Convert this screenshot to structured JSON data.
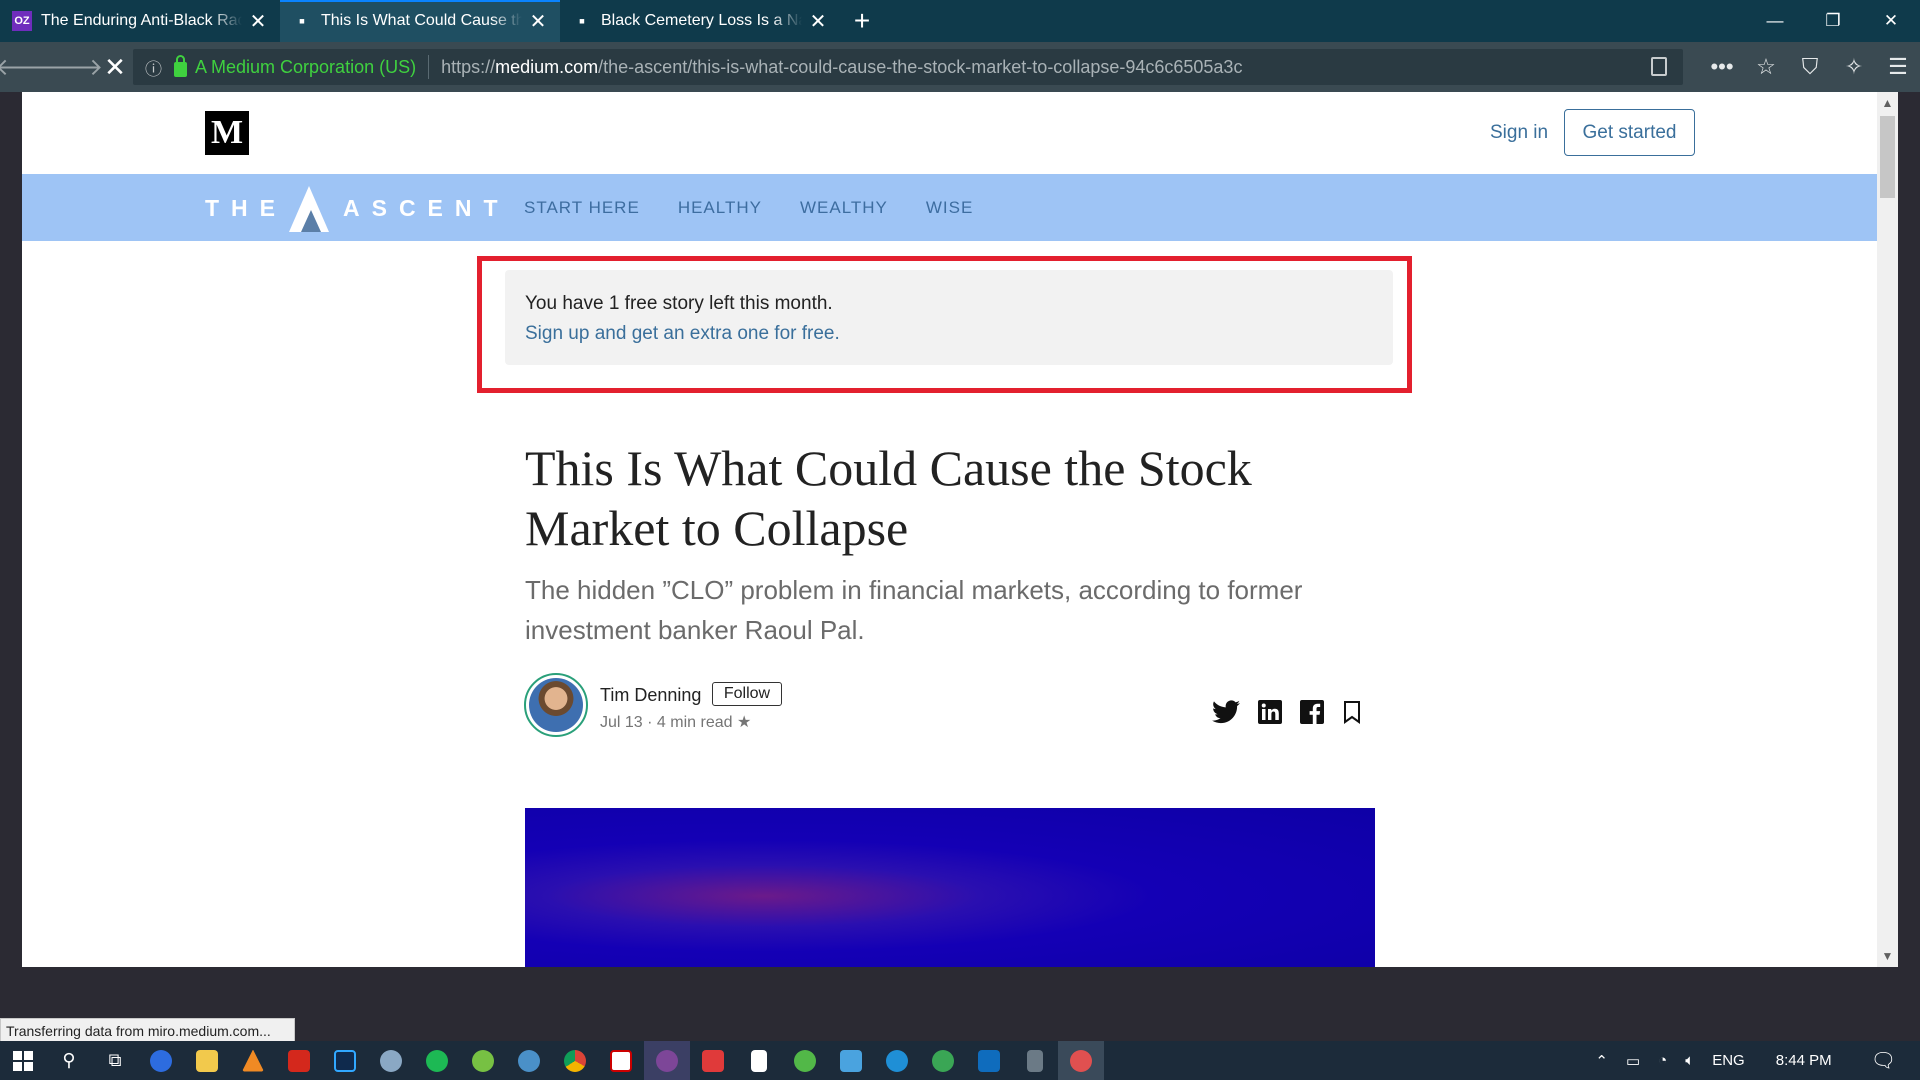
{
  "browser": {
    "tabs": [
      {
        "title": "The Enduring Anti-Black Racism of",
        "favicon": "OZ",
        "active": false
      },
      {
        "title": "This Is What Could Cause the Stock",
        "favicon": "",
        "active": true
      },
      {
        "title": "Black Cemetery Loss Is a National",
        "favicon": "",
        "active": false
      }
    ],
    "new_tab_glyph": "+",
    "window_controls": [
      "—",
      "❐",
      "✕"
    ],
    "corp_label": "A Medium Corporation (US)",
    "url_prefix": "https://",
    "url_domain": "medium.com",
    "url_path": "/the-ascent/this-is-what-could-cause-the-stock-market-to-collapse-94c6c6505a3c",
    "status_text": "Transferring data from miro.medium.com..."
  },
  "header": {
    "logo": "M",
    "signin": "Sign in",
    "get_started": "Get started"
  },
  "publication": {
    "name_left": "THE",
    "name_right": "ASCENT",
    "nav": [
      "START HERE",
      "HEALTHY",
      "WEALTHY",
      "WISE"
    ]
  },
  "notice": {
    "line1": "You have 1 free story left this month.",
    "line2": "Sign up and get an extra one for free."
  },
  "article": {
    "title": "This Is What Could Cause the Stock Market to Collapse",
    "subtitle": "The hidden ”CLO” problem in financial markets, according to former investment banker Raoul Pal.",
    "author": "Tim Denning",
    "follow": "Follow",
    "meta": "Jul 13 · 4 min read ★"
  },
  "taskbar": {
    "lang": "ENG",
    "time": "8:44 PM"
  }
}
